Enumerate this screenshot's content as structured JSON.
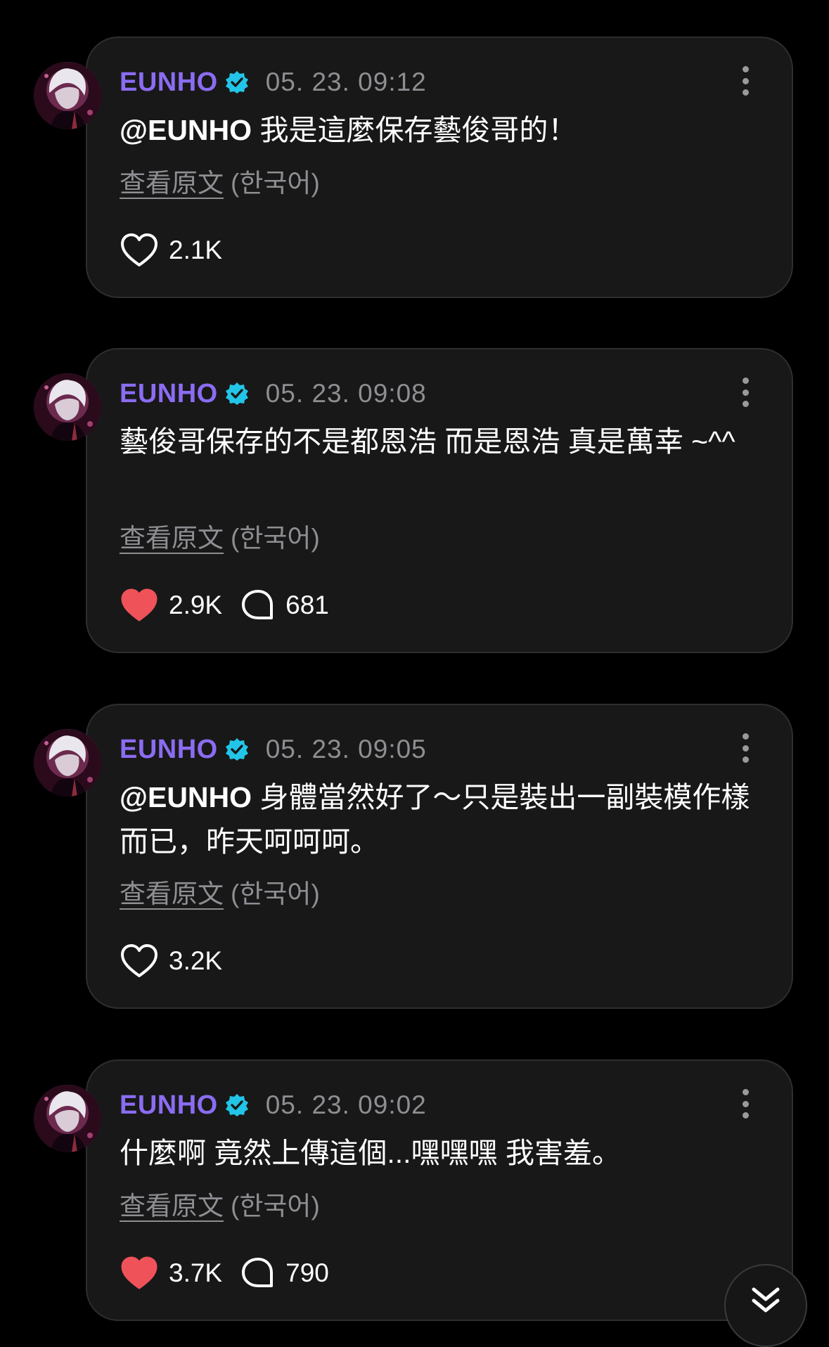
{
  "posts": [
    {
      "author": "EUNHO",
      "time": "05. 23. 09:12",
      "mention": "@EUNHO",
      "text": " 我是這麼保存藝俊哥的！",
      "view_original": "查看原文",
      "language": "(한국어)",
      "likes": "2.1K",
      "liked": false
    },
    {
      "author": "EUNHO",
      "time": "05. 23. 09:08",
      "mention": "",
      "text": "藝俊哥保存的不是都恩浩 而是恩浩 真是萬幸 ~^^",
      "view_original": "查看原文",
      "language": "(한국어)",
      "likes": "2.9K",
      "liked": true,
      "replies": "681"
    },
    {
      "author": "EUNHO",
      "time": "05. 23. 09:05",
      "mention": "@EUNHO",
      "text": " 身體當然好了～只是裝出一副裝模作樣而已，昨天呵呵呵。",
      "view_original": "查看原文",
      "language": "(한국어)",
      "likes": "3.2K",
      "liked": false
    },
    {
      "author": "EUNHO",
      "time": "05. 23. 09:02",
      "mention": "",
      "text": "什麼啊 竟然上傳這個...嘿嘿嘿 我害羞。",
      "view_original": "查看原文",
      "language": "(한국어)",
      "likes": "3.7K",
      "liked": true,
      "replies": "790"
    }
  ],
  "colors": {
    "name": "#8b6cf2",
    "verified": "#22c5e8",
    "liked_heart": "#f0525a",
    "meta_gray": "#8e8e93",
    "card_bg": "#181818"
  },
  "icons": {
    "verified": "verified-badge-icon",
    "more": "more-vertical-icon",
    "like": "heart-icon",
    "reply": "speech-bubble-icon",
    "scroll": "double-chevron-down-icon"
  }
}
